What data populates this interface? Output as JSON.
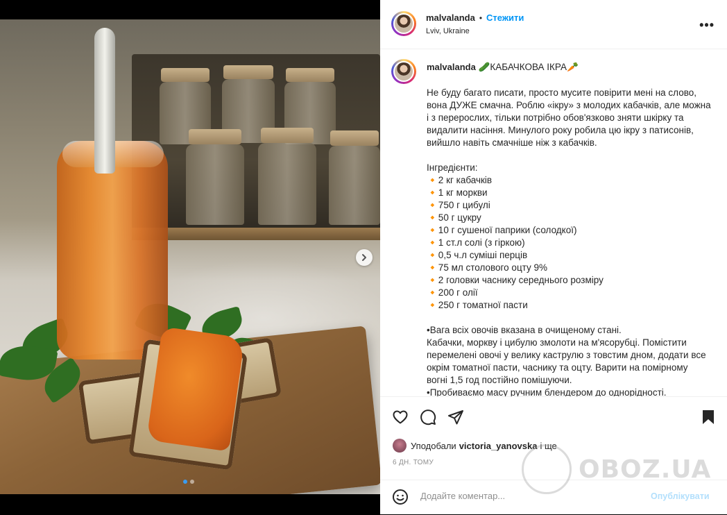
{
  "post": {
    "username": "malvalanda",
    "follow_label": "Стежити",
    "separator": "•",
    "location": "Lviv, Ukraine",
    "more_label": "•••",
    "photo_nav": {
      "next_label": "›",
      "slide_count": 2,
      "active_slide": 1
    }
  },
  "caption": {
    "username": "malvalanda",
    "title": "🥒КАБАЧКОВА ІКРА🥕",
    "intro": "Не буду багато писати, просто мусите повірити мені на слово, вона ДУЖЕ смачна. Роблю «ікру» з молодих кабачків, але можна і з перерослих, тільки потрібно обов'язково зняти шкірку та видалити насіння. Минулого року робила цю ікру з патисонів, вийшло навіть смачніше ніж з кабачків.",
    "ingredients_title": "Інгредієнти:",
    "ingredients": [
      "🔸2 кг кабачків",
      "🔸1 кг моркви",
      "🔸750 г цибулі",
      "🔸50 г цукру",
      "🔸10 г сушеної паприки (солодкої)",
      "🔸1 ст.л солі (з гіркою)",
      "🔸0,5 ч.л суміші перців",
      "🔸75 мл столового оцту 9%",
      "🔸2 головки часнику середнього розміру",
      "🔸200 г олії",
      "🔸250 г томатної пасти"
    ],
    "note": "•Вага всіх овочів вказана в очищеному стані.",
    "steps": [
      "Кабачки, моркву і цибулю змолоти на м'ясорубці. Помістити перемелені овочі у велику каструлю з товстим дном, додати все окрім томатної пасти, часнику та оцту. Варити на помірному вогні 1,5 год постійно помішуючи.",
      "•Пробиваємо масу ручним блендером до однорідності."
    ]
  },
  "actions": {
    "liked_by_prefix": "Уподобали",
    "liked_by_user": "victoria_yanovska",
    "liked_by_suffix": "і ще",
    "timestamp": "6 ДН. ТОМУ"
  },
  "comment": {
    "placeholder": "Додайте коментар...",
    "post_label": "Опублікувати"
  },
  "watermark": {
    "text": "OBOZ.UA"
  },
  "colors": {
    "accent": "#0095f6",
    "post_disabled": "#b2dffc",
    "text": "#262626",
    "muted": "#8e8e8e"
  }
}
